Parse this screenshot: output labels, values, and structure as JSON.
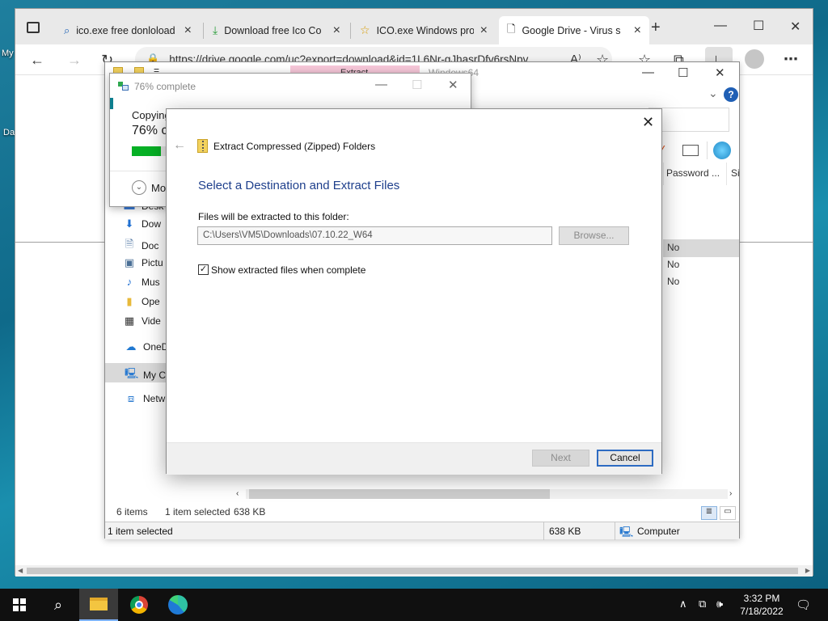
{
  "desktop": {
    "icon_label_1": "My",
    "icon_label_2": "Da"
  },
  "browser": {
    "tabs": [
      {
        "title": "ico.exe free donloload",
        "icon": "search-icon"
      },
      {
        "title": "Download free Ico Co",
        "icon": "download-tray-icon"
      },
      {
        "title": "ICO.exe Windows pro",
        "icon": "star-icon"
      },
      {
        "title": "Google Drive - Virus s",
        "icon": "page-icon"
      }
    ],
    "address": "https://drive.google.com/uc?export=download&id=1L6Nr-gJhasrDfv6rsNpv..."
  },
  "explorer": {
    "ribbon_tab": "Extract",
    "title": "Windows64",
    "column_headers": [
      "Password ...",
      "Si"
    ],
    "rows": [
      "No",
      "No",
      "No"
    ],
    "nav_items": [
      {
        "label": "Desk",
        "icon": "desktop-icon"
      },
      {
        "label": "Dow",
        "icon": "downloads-icon"
      },
      {
        "label": "Doc",
        "icon": "documents-icon"
      },
      {
        "label": "Pictu",
        "icon": "pictures-icon"
      },
      {
        "label": "Mus",
        "icon": "music-icon"
      },
      {
        "label": "Ope",
        "icon": "folder-icon"
      },
      {
        "label": "Vide",
        "icon": "videos-icon"
      },
      {
        "label": "OneD",
        "icon": "onedrive-icon"
      },
      {
        "label": "My Co",
        "icon": "computer-icon"
      },
      {
        "label": "Netw",
        "icon": "network-icon"
      }
    ],
    "status_items": "6 items",
    "status_selected": "1 item selected",
    "status_size": "638 KB",
    "status2_selected": "1 item selected",
    "status2_size": "638 KB",
    "status2_location": "Computer"
  },
  "progress": {
    "title": "76% complete",
    "line1": "Copying",
    "pct_text": "76% c",
    "more": "Mo",
    "fraction": 0.76
  },
  "wizard": {
    "header": "Extract Compressed (Zipped) Folders",
    "heading": "Select a Destination and Extract Files",
    "label": "Files will be extracted to this folder:",
    "path": "C:\\Users\\VM5\\Downloads\\07.10.22_W64",
    "browse": "Browse...",
    "checkbox_label": "Show extracted files when complete",
    "checkbox_checked": true,
    "next": "Next",
    "cancel": "Cancel"
  },
  "taskbar": {
    "time": "3:32 PM",
    "date": "7/18/2022"
  }
}
